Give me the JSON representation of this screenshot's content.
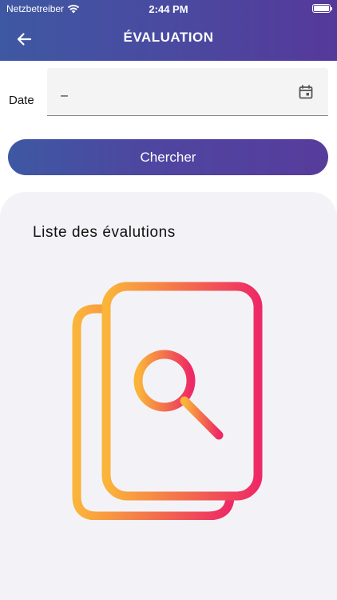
{
  "status_bar": {
    "carrier": "Netzbetreiber",
    "time": "2:44 PM"
  },
  "nav": {
    "title": "ÉVALUATION"
  },
  "filter": {
    "date_label": "Date",
    "date_value": "–"
  },
  "search_button": {
    "label": "Chercher"
  },
  "list": {
    "title": "Liste des évalutions"
  },
  "colors": {
    "header_gradient_start": "#3e58a3",
    "header_gradient_end": "#55399a",
    "illustration_gradient_start": "#fbb43a",
    "illustration_gradient_end": "#ee2a66",
    "card_background": "#f3f3f7"
  },
  "icons": {
    "back": "arrow-left-icon",
    "calendar": "calendar-icon",
    "wifi": "wifi-icon",
    "battery": "battery-icon",
    "illustration": "document-search-icon"
  }
}
